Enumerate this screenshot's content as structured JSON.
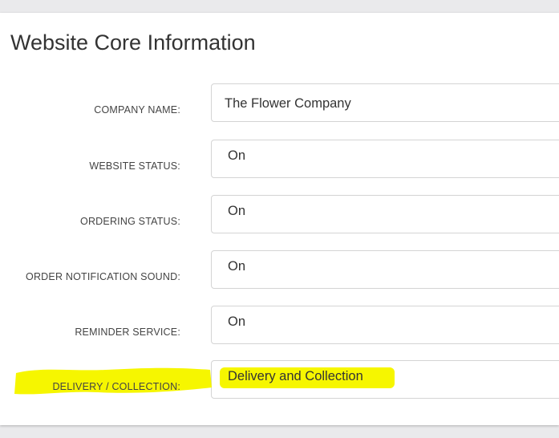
{
  "panel": {
    "title": "Website Core Information"
  },
  "fields": [
    {
      "label": "COMPANY NAME:",
      "value": "The Flower Company"
    },
    {
      "label": "WEBSITE STATUS:",
      "value": "On"
    },
    {
      "label": "ORDERING STATUS:",
      "value": "On"
    },
    {
      "label": "ORDER NOTIFICATION SOUND:",
      "value": "On"
    },
    {
      "label": "REMINDER SERVICE:",
      "value": "On"
    },
    {
      "label": "DELIVERY / COLLECTION:",
      "value": "Delivery and Collection"
    }
  ],
  "highlight_color": "#f6f600"
}
